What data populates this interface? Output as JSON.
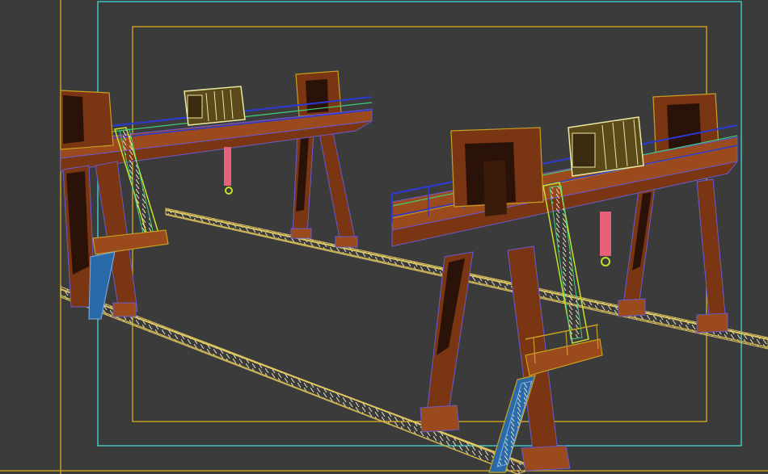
{
  "viewport": {
    "background": "#3b3b3b",
    "frame_colors": {
      "outer_safe_frame": "#c8a020",
      "action_safe_frame": "#3fc4c4",
      "title_safe_frame": "#c8a020"
    }
  },
  "scene": {
    "objects": [
      "left-gantry-crane",
      "right-gantry-crane",
      "front-rail-track",
      "back-rail-track"
    ],
    "colors": {
      "steel": "#7a3512",
      "steel_light": "#9a4a1c",
      "steel_dark": "#2a1208",
      "wire_edge": "#6a5ad0",
      "railing": "#2a3ad8",
      "railing_green": "#3fd07a",
      "ladder": "#c8e02a",
      "trolley": "#e8e8a0",
      "hook_cable": "#e8607a",
      "rail": "#d8c060"
    }
  }
}
